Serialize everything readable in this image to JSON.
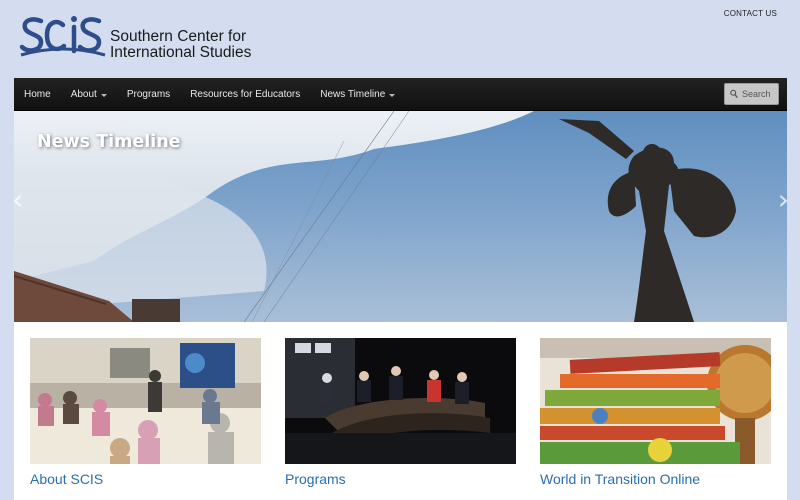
{
  "header": {
    "contact_label": "CONTACT US",
    "logo_mark": "SCIS",
    "org_name_line1": "Southern Center for",
    "org_name_line2": "International Studies"
  },
  "nav": {
    "items": [
      {
        "label": "Home",
        "has_dropdown": false
      },
      {
        "label": "About",
        "has_dropdown": true
      },
      {
        "label": "Programs",
        "has_dropdown": false
      },
      {
        "label": "Resources for Educators",
        "has_dropdown": false
      },
      {
        "label": "News Timeline",
        "has_dropdown": true
      }
    ],
    "search_placeholder": "Search",
    "search_icon": "magnifier-icon"
  },
  "slider": {
    "title": "News Timeline",
    "prev_icon": "chevron-left-icon",
    "next_icon": "chevron-right-icon"
  },
  "cards": [
    {
      "title": "About SCIS",
      "text": ""
    },
    {
      "title": "Programs",
      "text": ""
    },
    {
      "title": "World in Transition Online",
      "text": ""
    }
  ],
  "colors": {
    "page_background": "#d4ddf0",
    "nav_background": "#1a1a1a",
    "link_blue": "#2a6db0",
    "logo_blue": "#2d4e8a"
  }
}
